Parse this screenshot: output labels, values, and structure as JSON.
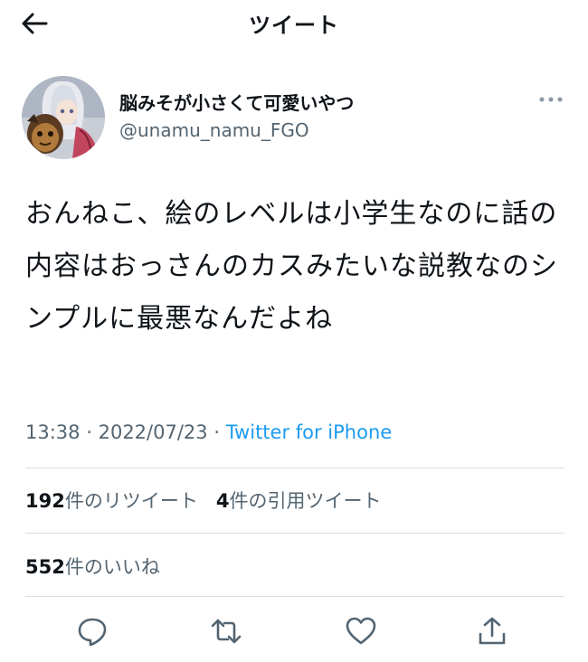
{
  "header": {
    "title": "ツイート",
    "back_icon": "back-arrow-icon"
  },
  "author": {
    "display_name": "脳みそが小さくて可愛いやつ",
    "handle": "@unamu_namu_FGO",
    "avatar": "avatar-image",
    "more_icon": "more-dots-icon"
  },
  "tweet": {
    "text": "おんねこ、絵のレベルは小学生なのに話の内容はおっさんのカスみたいな説教なのシンプルに最悪なんだよね",
    "time": "13:38",
    "separator": "·",
    "date": "2022/07/23",
    "source": "Twitter for iPhone"
  },
  "stats": {
    "retweets_count": "192",
    "retweets_label": "件のリツイート",
    "quotes_count": "4",
    "quotes_label": "件の引用ツイート",
    "likes_count": "552",
    "likes_label": "件のいいね"
  },
  "actions": [
    {
      "icon": "reply-icon"
    },
    {
      "icon": "retweet-icon"
    },
    {
      "icon": "like-icon"
    },
    {
      "icon": "share-icon"
    }
  ],
  "colors": {
    "text": "#0f1419",
    "muted": "#536471",
    "link": "#1d9bf0",
    "divider": "#dadfe3"
  }
}
